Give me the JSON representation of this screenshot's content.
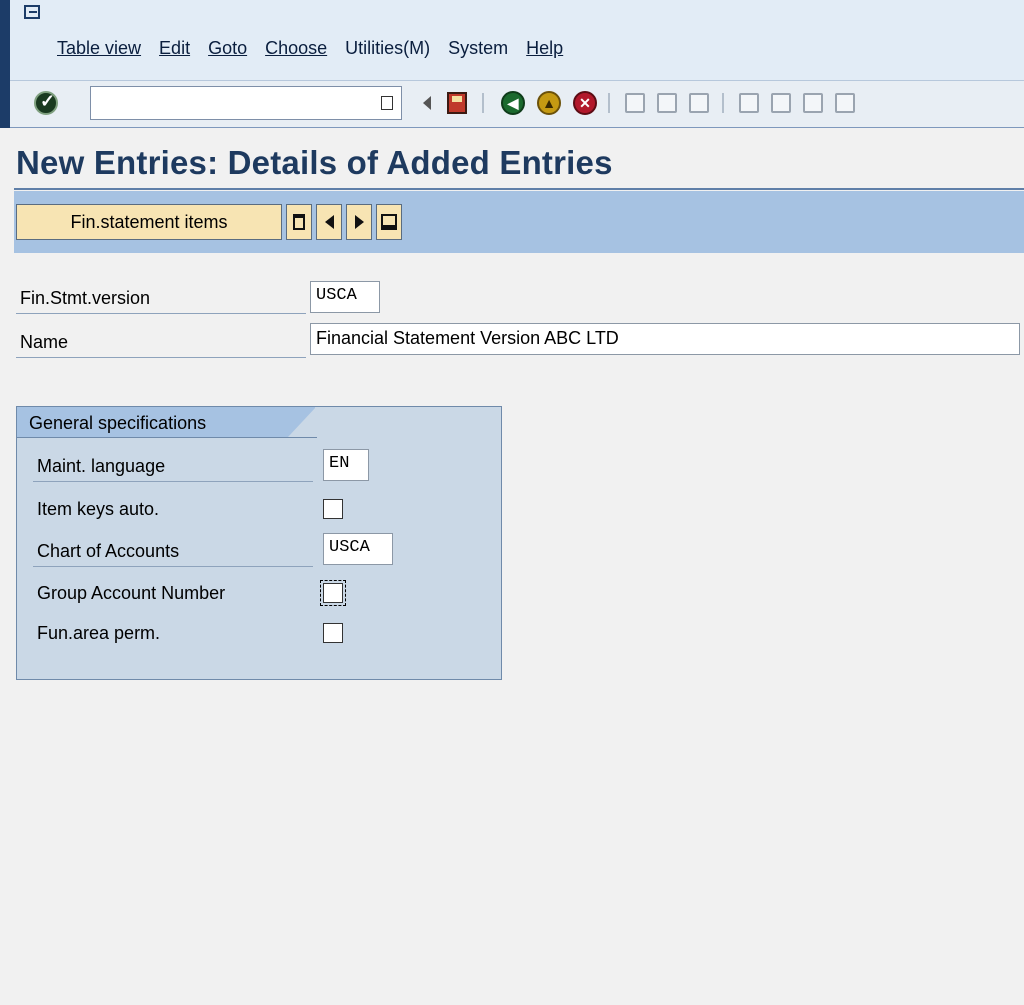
{
  "menu": [
    "Table view",
    "Edit",
    "Goto",
    "Choose",
    "Utilities(M)",
    "System",
    "Help"
  ],
  "title": "New Entries: Details of Added Entries",
  "app_toolbar": {
    "fin_items_label": "Fin.statement items"
  },
  "header": {
    "version_label": "Fin.Stmt.version",
    "version_value": "USCA",
    "name_label": "Name",
    "name_value": "Financial Statement Version ABC LTD"
  },
  "group": {
    "title": "General specifications",
    "maint_lang_label": "Maint. language",
    "maint_lang_value": "EN",
    "item_keys_label": "Item keys auto.",
    "item_keys_checked": false,
    "coa_label": "Chart of Accounts",
    "coa_value": "USCA",
    "group_acct_label": "Group Account Number",
    "group_acct_checked": false,
    "fun_area_label": "Fun.area perm.",
    "fun_area_checked": false
  }
}
